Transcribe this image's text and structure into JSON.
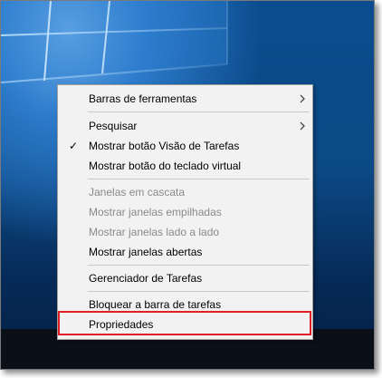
{
  "context_menu": {
    "items": [
      {
        "label": "Barras de ferramentas",
        "submenu": true,
        "enabled": true,
        "checked": false
      },
      {
        "label": "Pesquisar",
        "submenu": true,
        "enabled": true,
        "checked": false
      },
      {
        "label": "Mostrar botão Visão de Tarefas",
        "submenu": false,
        "enabled": true,
        "checked": true
      },
      {
        "label": "Mostrar botão do teclado virtual",
        "submenu": false,
        "enabled": true,
        "checked": false
      },
      {
        "label": "Janelas em cascata",
        "submenu": false,
        "enabled": false,
        "checked": false
      },
      {
        "label": "Mostrar janelas empilhadas",
        "submenu": false,
        "enabled": false,
        "checked": false
      },
      {
        "label": "Mostrar janelas lado a lado",
        "submenu": false,
        "enabled": false,
        "checked": false
      },
      {
        "label": "Mostrar janelas abertas",
        "submenu": false,
        "enabled": true,
        "checked": false
      },
      {
        "label": "Gerenciador de Tarefas",
        "submenu": false,
        "enabled": true,
        "checked": false
      },
      {
        "label": "Bloquear a barra de tarefas",
        "submenu": false,
        "enabled": true,
        "checked": false
      },
      {
        "label": "Propriedades",
        "submenu": false,
        "enabled": true,
        "checked": false
      }
    ],
    "highlighted_item": "Propriedades"
  },
  "colors": {
    "highlight_border": "#e01e26",
    "menu_background": "#f2f2f2",
    "disabled_text": "#8a8a8a",
    "taskbar": "#0b0f17"
  },
  "icons": {
    "submenu": "chevron-right-icon",
    "checked": "checkmark-icon"
  }
}
